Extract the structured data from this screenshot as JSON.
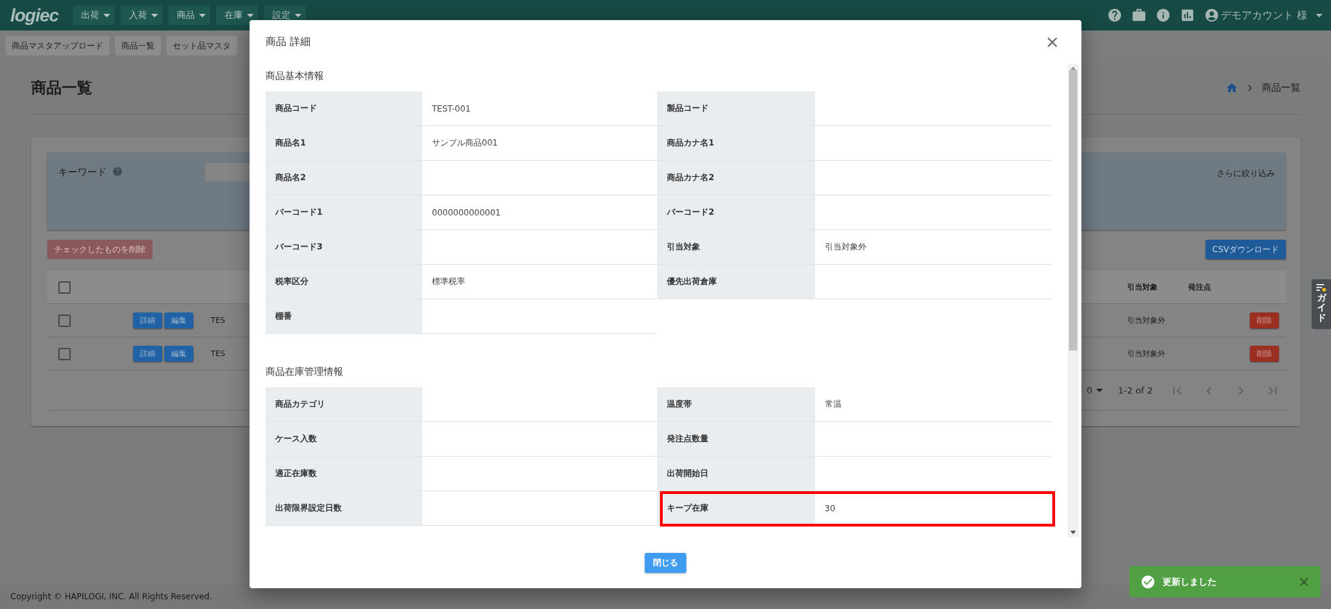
{
  "top_bar": {
    "logo": "logiec",
    "menus": [
      {
        "label": "出荷"
      },
      {
        "label": "入荷"
      },
      {
        "label": "商品"
      },
      {
        "label": "在庫"
      },
      {
        "label": "設定"
      }
    ],
    "account": "デモアカウント 様"
  },
  "sub_nav": [
    "商品マスタアップロード",
    "商品一覧",
    "セット品マスタ"
  ],
  "page": {
    "title": "商品一覧",
    "breadcrumb": "商品一覧"
  },
  "filter": {
    "keyword_label": "キーワード",
    "more_filters": "さらに絞り込み"
  },
  "actions": {
    "delete_checked": {
      "label": "チェックしたものを削除",
      "disabled": true
    },
    "csv": "CSVダウンロード"
  },
  "table": {
    "header_checked": false,
    "columns": [
      {
        "label": "引当対象"
      },
      {
        "label": "発注点"
      }
    ],
    "rows": [
      {
        "checked": false,
        "detail": "詳細",
        "edit": "編集",
        "code": "TES",
        "allocation": "引当対象外",
        "delete": "削除"
      },
      {
        "checked": false,
        "detail": "詳細",
        "edit": "編集",
        "code": "TES",
        "allocation": "引当対象外",
        "delete": "削除"
      }
    ]
  },
  "pagination": {
    "rows_per_page": "0",
    "range": "1-2 of 2"
  },
  "footer": "Copyright © HAPILOGI, INC. All Rights Reserved.",
  "modal": {
    "title": "商品 詳細",
    "sections": [
      {
        "heading": "商品基本情報",
        "fields": [
          {
            "label": "商品コード",
            "value": "TEST-001",
            "highlighted": false
          },
          {
            "label": "製品コード",
            "highlighted": false
          },
          {
            "label": "商品名1",
            "value": "サンプル商品001",
            "highlighted": false
          },
          {
            "label": "商品カナ名1",
            "highlighted": false
          },
          {
            "label": "商品名2",
            "highlighted": false
          },
          {
            "label": "商品カナ名2",
            "highlighted": false
          },
          {
            "label": "バーコード1",
            "value": "0000000000001",
            "highlighted": false
          },
          {
            "label": "バーコード2",
            "highlighted": false
          },
          {
            "label": "バーコード3",
            "highlighted": false
          },
          {
            "label": "引当対象",
            "value": "引当対象外",
            "highlighted": false
          },
          {
            "label": "税率区分",
            "value": "標準税率",
            "highlighted": false
          },
          {
            "label": "優先出荷倉庫",
            "highlighted": false
          },
          {
            "label": "棚番",
            "highlighted": false
          }
        ]
      },
      {
        "heading": "商品在庫管理情報",
        "fields": [
          {
            "label": "商品カテゴリ",
            "highlighted": false
          },
          {
            "label": "温度帯",
            "value": "常温",
            "highlighted": false
          },
          {
            "label": "ケース入数",
            "highlighted": false
          },
          {
            "label": "発注点数量",
            "highlighted": false
          },
          {
            "label": "適正在庫数",
            "highlighted": false
          },
          {
            "label": "出荷開始日",
            "highlighted": false
          },
          {
            "label": "出荷限界設定日数",
            "highlighted": false
          },
          {
            "label": "キープ在庫",
            "value": "30",
            "highlighted": true
          }
        ]
      }
    ],
    "close_button": "閉じる"
  },
  "toast": {
    "message": "更新しました"
  },
  "guide_tab": "ガイド"
}
